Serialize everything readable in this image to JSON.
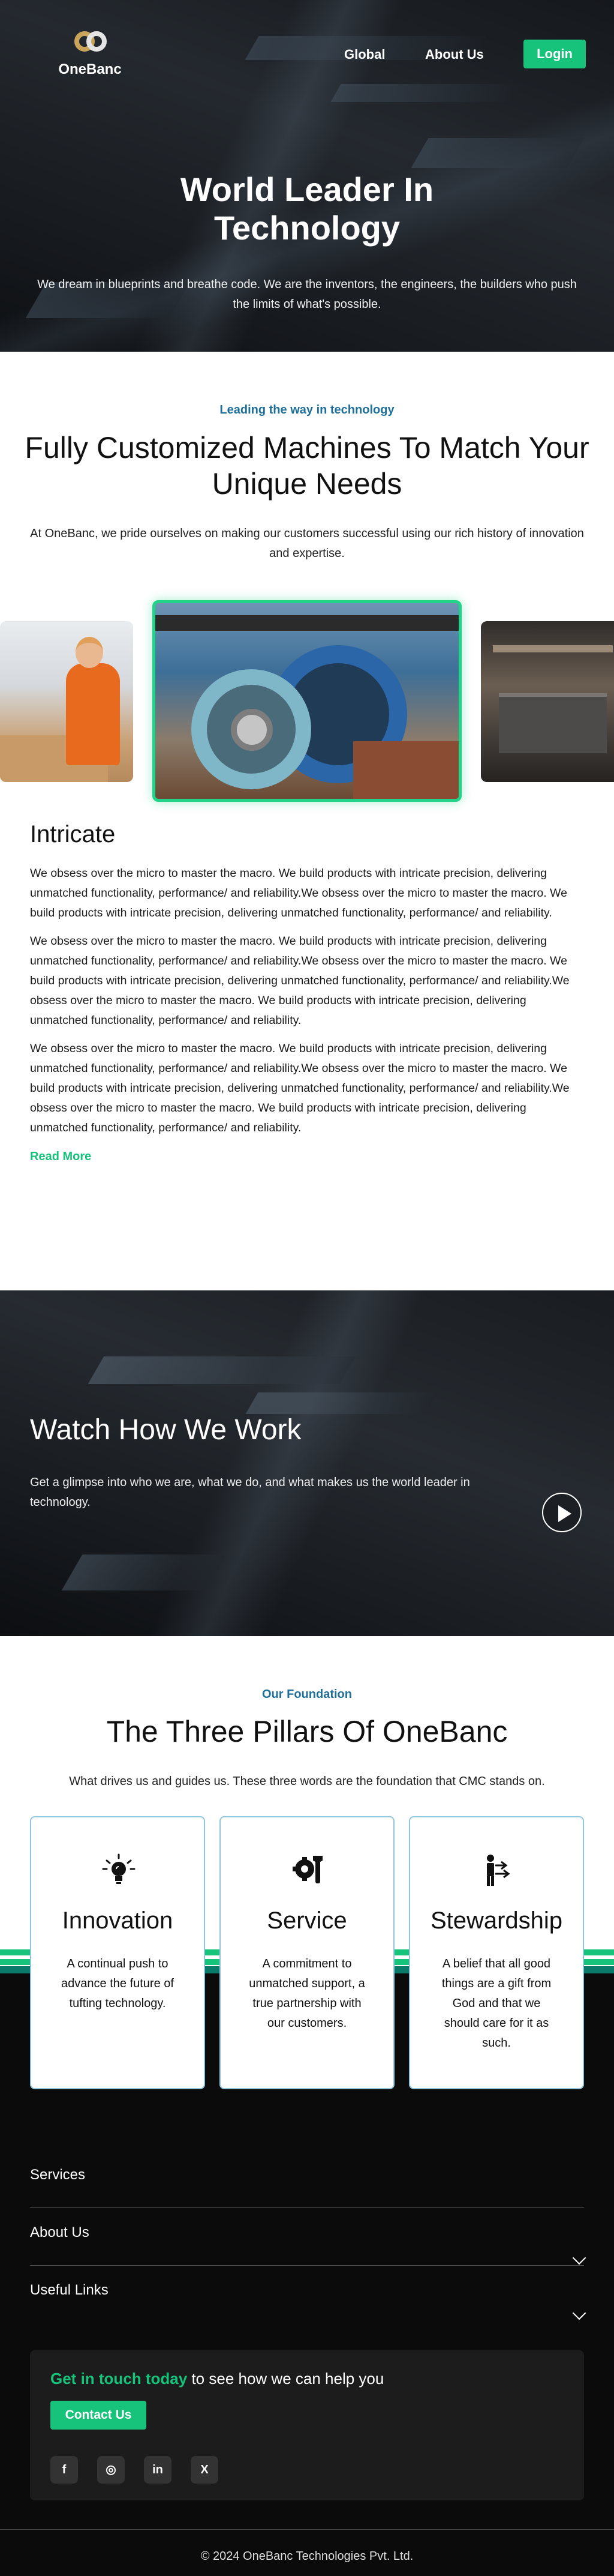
{
  "header": {
    "logo_text": "OneBanc",
    "nav": [
      {
        "label": "Global"
      },
      {
        "label": "About Us"
      }
    ],
    "login_label": "Login"
  },
  "hero": {
    "title_line1": "World Leader In",
    "title_line2": "Technology",
    "subtitle": "We dream in blueprints and breathe code. We are the inventors, the engineers, the builders who push the limits of what's possible."
  },
  "customized": {
    "eyebrow": "Leading the way in technology",
    "title": "Fully Customized Machines To Match Your Unique Needs",
    "lead": "At OneBanc, we pride ourselves on making our customers successful using our rich history of innovation and expertise."
  },
  "intricate": {
    "title": "Intricate",
    "paragraphs": [
      "We obsess over the micro to master the macro. We build products with intricate precision, delivering unmatched functionality, performance/ and reliability.We obsess over the micro to master the macro. We build products with intricate precision, delivering unmatched functionality, performance/ and reliability.",
      "We obsess over the micro to master the macro. We build products with intricate precision, delivering unmatched functionality, performance/ and reliability.We obsess over the micro to master the macro. We build products with intricate precision, delivering unmatched functionality, performance/ and reliability.We obsess over the micro to master the macro. We build products with intricate precision, delivering unmatched functionality, performance/ and reliability.",
      "We obsess over the micro to master the macro. We build products with intricate precision, delivering unmatched functionality, performance/ and reliability.We obsess over the micro to master the macro. We build products with intricate precision, delivering unmatched functionality, performance/ and reliability.We obsess over the micro to master the macro. We build products with intricate precision, delivering unmatched functionality, performance/ and reliability."
    ],
    "read_more": "Read More"
  },
  "watch": {
    "title": "Watch How We Work",
    "text": "Get a glimpse into who we are, what we do, and what makes us the world leader in technology."
  },
  "pillars": {
    "eyebrow": "Our Foundation",
    "title": "The Three Pillars Of OneBanc",
    "lead": "What drives us and guides us. These three words are the foundation that CMC stands on.",
    "cards": [
      {
        "icon": "lightbulb-icon",
        "title": "Innovation",
        "text": "A continual push to advance the future of tufting technology."
      },
      {
        "icon": "tools-icon",
        "title": "Service",
        "text": "A commitment to unmatched support, a true partnership with our customers."
      },
      {
        "icon": "stewardship-icon",
        "title": "Stewardship",
        "text": "A belief that all good things are a gift from God and that we should care for it as such."
      }
    ]
  },
  "footer": {
    "links": [
      {
        "label": "Services"
      },
      {
        "label": "About Us"
      },
      {
        "label": "Useful Links"
      }
    ],
    "contact_highlight": "Get in touch today",
    "contact_rest": " to see how we can help you",
    "contact_button": "Contact Us",
    "socials": [
      {
        "icon": "facebook-icon",
        "glyph": "f"
      },
      {
        "icon": "instagram-icon",
        "glyph": "◎"
      },
      {
        "icon": "linkedin-icon",
        "glyph": "in"
      },
      {
        "icon": "x-icon",
        "glyph": "X"
      }
    ],
    "copyright": "© 2024 OneBanc Technologies Pvt. Ltd."
  },
  "colors": {
    "accent_green": "#17c27a",
    "eyebrow_blue": "#1d6f9a",
    "card_border": "#8fc6de"
  }
}
